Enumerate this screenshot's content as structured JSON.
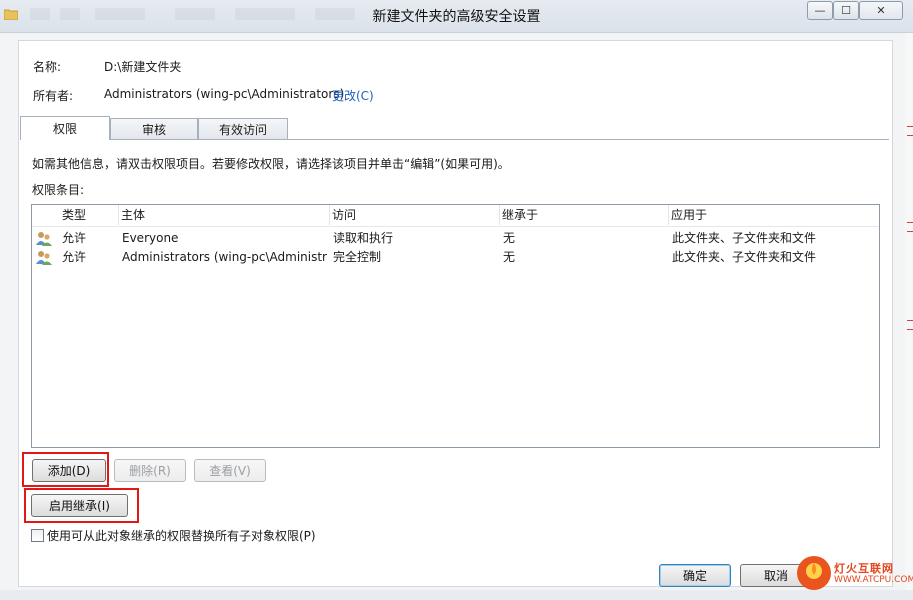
{
  "window": {
    "title": "新建文件夹的高级安全设置",
    "min_glyph": "—",
    "max_glyph": "☐",
    "close_glyph": "✕",
    "folder_icon": "folder-icon"
  },
  "info": {
    "name_label": "名称:",
    "name_value": "D:\\新建文件夹",
    "owner_label": "所有者:",
    "owner_value": "Administrators (wing-pc\\Administrators)",
    "change_link": "更改(C)"
  },
  "tabs": [
    {
      "label": "权限",
      "active": true
    },
    {
      "label": "审核",
      "active": false
    },
    {
      "label": "有效访问",
      "active": false
    }
  ],
  "permissions": {
    "hint": "如需其他信息，请双击权限项目。若要修改权限，请选择该项目并单击“编辑”(如果可用)。",
    "entries_label": "权限条目:",
    "columns": [
      "类型",
      "主体",
      "访问",
      "继承于",
      "应用于"
    ],
    "rows": [
      {
        "icon": "users-icon",
        "type": "允许",
        "principal": "Everyone",
        "access": "读取和执行",
        "inherited_from": "无",
        "applies_to": "此文件夹、子文件夹和文件"
      },
      {
        "icon": "users-icon",
        "type": "允许",
        "principal": "Administrators (wing-pc\\Administr...",
        "access": "完全控制",
        "inherited_from": "无",
        "applies_to": "此文件夹、子文件夹和文件"
      }
    ]
  },
  "buttons": {
    "add": "添加(D)",
    "remove": "删除(R)",
    "view": "查看(V)",
    "enable_inheritance": "启用继承(I)",
    "ok": "确定",
    "cancel": "取消"
  },
  "checkbox": {
    "label": "使用可从此对象继承的权限替换所有子对象权限(P)",
    "checked": false
  },
  "watermark": {
    "line1": "灯火互联网",
    "line2": "WWW.ATCPU.COM"
  },
  "colors": {
    "highlight": "#e01818",
    "link": "#1e5fbf",
    "watermark": "#e2461c"
  }
}
